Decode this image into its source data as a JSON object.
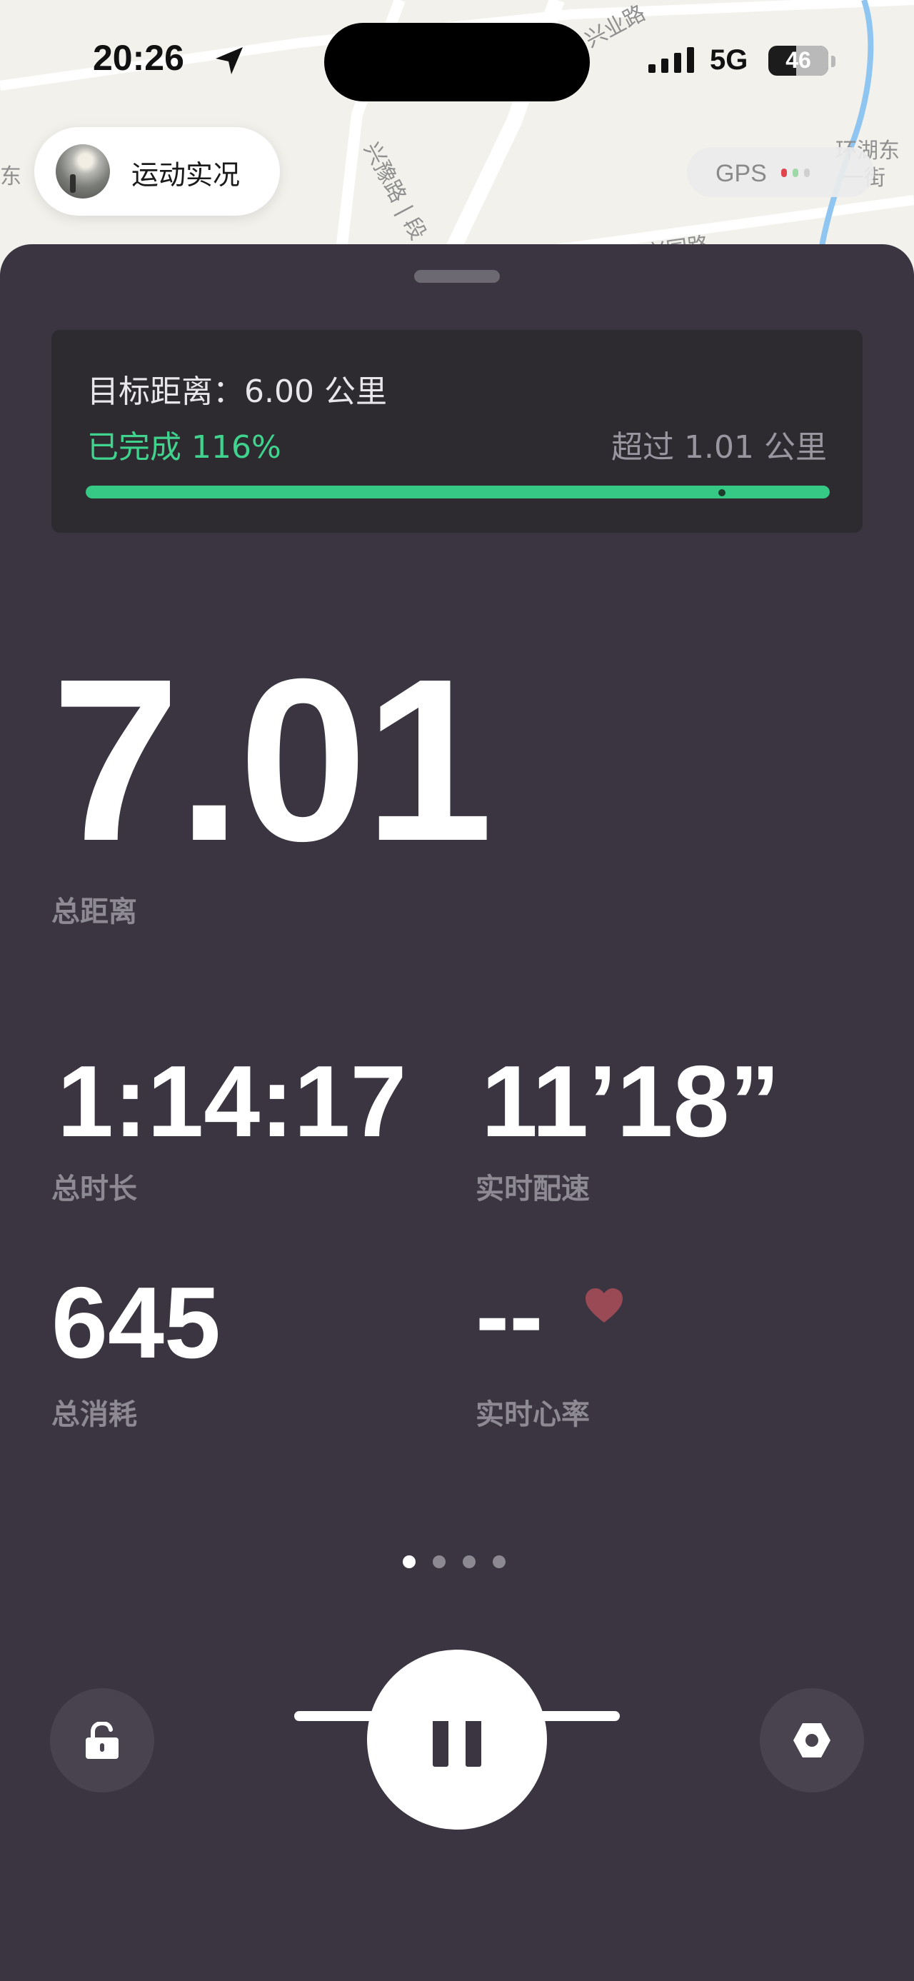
{
  "status_bar": {
    "time": "20:26",
    "network": "5G",
    "battery": "46",
    "battery_level": 0.46
  },
  "map": {
    "labels": [
      "兴业路",
      "兴豫路 | 段",
      "兴园路",
      "环湖东",
      "一街",
      "东"
    ]
  },
  "header": {
    "live_label": "运动实况",
    "gps_label": "GPS",
    "gps_signal_colors": [
      "#e0454c",
      "#9fd8a8",
      "#cfcfcf"
    ]
  },
  "goal": {
    "title": "目标距离：6.00 公里",
    "completed": "已完成 116%",
    "exceeded": "超过 1.01 公里",
    "progress_fraction": 1.0,
    "accent_color": "#35c985"
  },
  "metrics": {
    "distance_value": "7.01",
    "distance_label": "总距离",
    "duration_value": "1:14:17",
    "duration_label": "总时长",
    "pace_value": "11’18”",
    "pace_label": "实时配速",
    "calories_value": "645",
    "calories_label": "总消耗",
    "heart_rate_value": "--",
    "heart_rate_label": "实时心率"
  },
  "pager": {
    "total": 4,
    "active": 0
  },
  "controls": {
    "lock_icon": "lock-open-icon",
    "pause_icon": "pause-icon",
    "settings_icon": "hexagon-settings-icon"
  }
}
